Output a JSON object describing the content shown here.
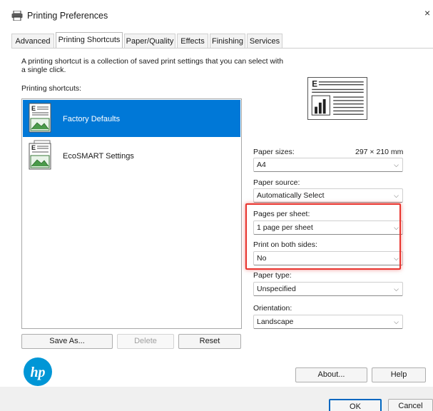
{
  "window": {
    "title": "Printing Preferences",
    "icon": "printer-icon",
    "close_glyph": "×"
  },
  "tabs": [
    {
      "label": "Advanced",
      "active": false
    },
    {
      "label": "Printing Shortcuts",
      "active": true
    },
    {
      "label": "Paper/Quality",
      "active": false
    },
    {
      "label": "Effects",
      "active": false
    },
    {
      "label": "Finishing",
      "active": false
    },
    {
      "label": "Services",
      "active": false
    }
  ],
  "shortcuts": {
    "description": "A printing shortcut is a collection of saved print settings that you can select with a single click.",
    "list_label": "Printing shortcuts:",
    "items": [
      {
        "label": "Factory Defaults",
        "selected": true
      },
      {
        "label": "EcoSMART Settings",
        "selected": false
      }
    ],
    "buttons": {
      "save_as": "Save As...",
      "delete": "Delete",
      "reset": "Reset"
    }
  },
  "settings": {
    "paper_sizes": {
      "label": "Paper sizes:",
      "dimension": "297 × 210 mm",
      "value": "A4"
    },
    "paper_source": {
      "label": "Paper source:",
      "value": "Automatically Select"
    },
    "pages_per_sheet": {
      "label": "Pages per sheet:",
      "value": "1 page per sheet"
    },
    "print_both_sides": {
      "label": "Print on both sides:",
      "value": "No"
    },
    "paper_type": {
      "label": "Paper type:",
      "value": "Unspecified"
    },
    "orientation": {
      "label": "Orientation:",
      "value": "Landscape"
    }
  },
  "buttons": {
    "about": "About...",
    "help": "Help",
    "ok": "OK",
    "cancel": "Cancel"
  },
  "colors": {
    "selection": "#0078d7",
    "highlight_box": "#e8342e",
    "hp_brand": "#0096d6"
  }
}
